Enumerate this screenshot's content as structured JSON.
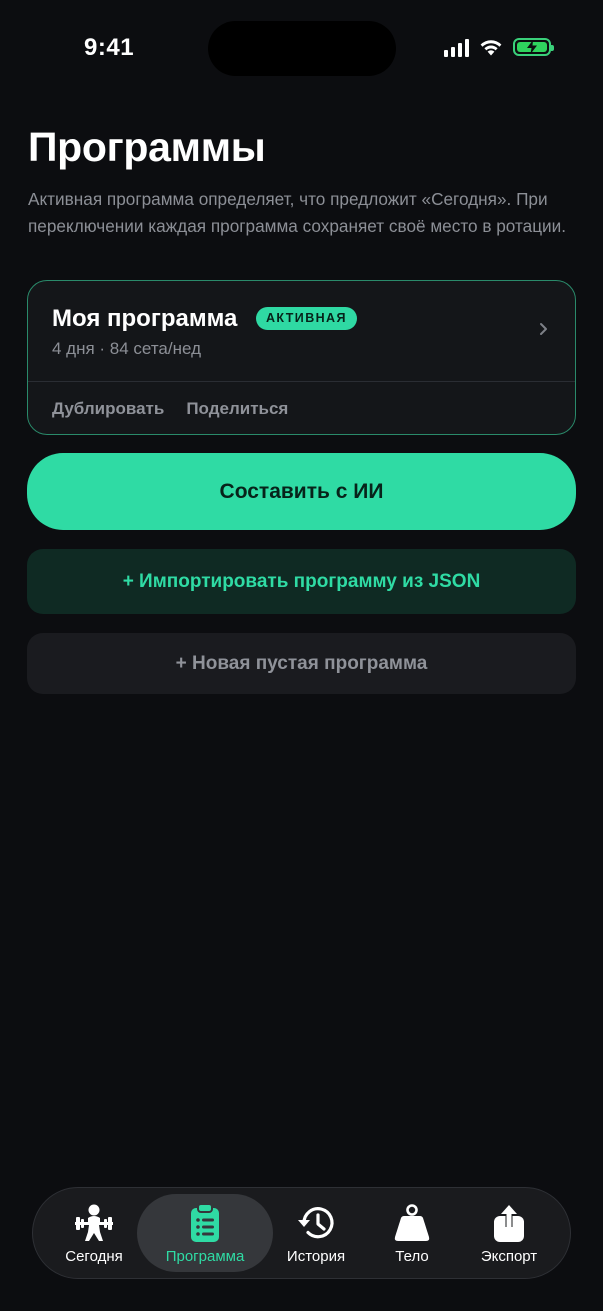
{
  "status_bar": {
    "time": "9:41"
  },
  "header": {
    "title": "Программы",
    "description": "Активная программа определяет, что предложит «Сегодня». При переключении каждая программа сохраняет своё место в ротации."
  },
  "program_card": {
    "name": "Моя программа",
    "badge": "АКТИВНАЯ",
    "meta": "4 дня · 84 сета/нед",
    "actions": [
      "Дублировать",
      "Поделиться"
    ]
  },
  "buttons": {
    "ai": "Составить с ИИ",
    "import": "+ Импортировать программу из JSON",
    "new": "+ Новая пустая программа"
  },
  "tab_bar": {
    "tabs": [
      {
        "label": "Сегодня",
        "icon": "weightlifter-icon"
      },
      {
        "label": "Программа",
        "icon": "clipboard-list-icon",
        "active": true
      },
      {
        "label": "История",
        "icon": "history-icon"
      },
      {
        "label": "Тело",
        "icon": "weight-icon"
      },
      {
        "label": "Экспорт",
        "icon": "share-icon"
      }
    ]
  },
  "colors": {
    "background": "#0c0d10",
    "accent": "#2fdba4",
    "card": "#141619",
    "muted_text": "#8c8f96"
  }
}
